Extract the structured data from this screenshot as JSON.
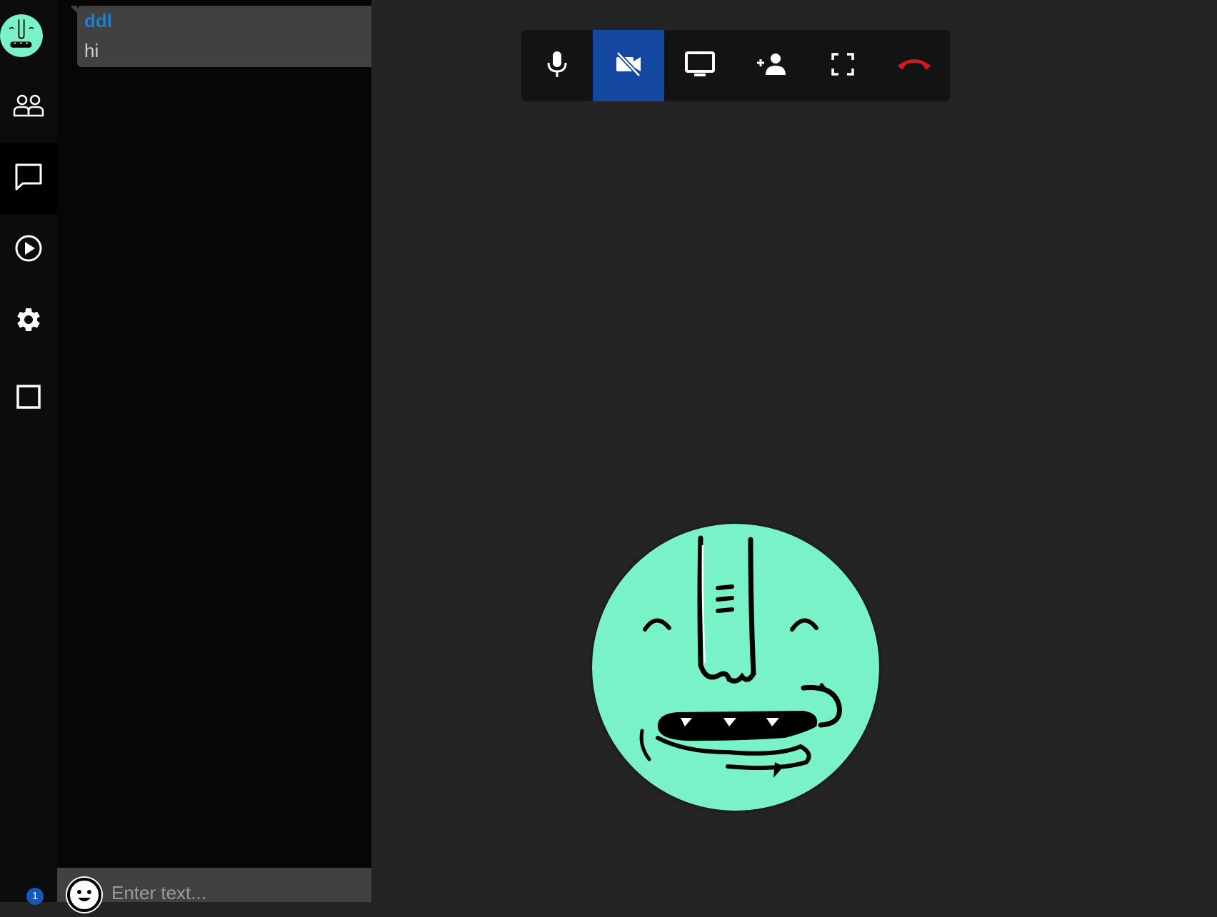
{
  "rail": {
    "items": [
      {
        "name": "people-icon"
      },
      {
        "name": "chat-bubble-icon",
        "active": true
      },
      {
        "name": "play-circle-icon"
      },
      {
        "name": "gear-icon"
      },
      {
        "name": "square-icon"
      }
    ],
    "badge_count": "1"
  },
  "chat": {
    "messages": [
      {
        "author": "ddl",
        "text": "hi"
      }
    ],
    "input_placeholder": "Enter text..."
  },
  "toolbar": {
    "buttons": [
      "microphone-icon",
      "video-off-icon",
      "screen-share-icon",
      "add-user-icon",
      "fullscreen-icon",
      "hang-up-icon"
    ],
    "active_button": "video-off-icon"
  },
  "colors": {
    "accent": "#1448a0",
    "author": "#1a7fd0",
    "hangup": "#d11b1b",
    "avatar": "#79f2c7"
  }
}
